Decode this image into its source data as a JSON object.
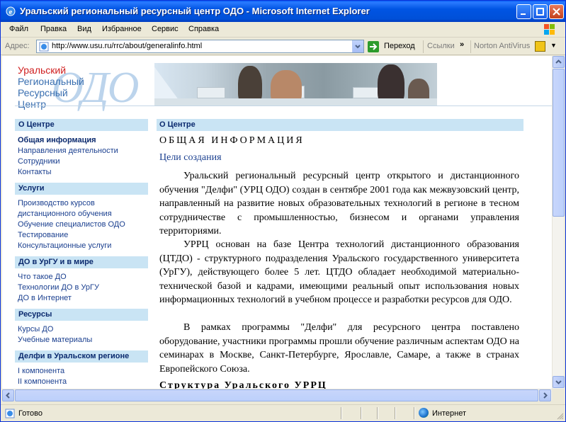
{
  "window": {
    "title": "Уральский региональный ресурсный центр ОДО - Microsoft Internet Explorer"
  },
  "menu": {
    "items": [
      {
        "label": "Файл"
      },
      {
        "label": "Правка"
      },
      {
        "label": "Вид"
      },
      {
        "label": "Избранное"
      },
      {
        "label": "Сервис"
      },
      {
        "label": "Справка"
      }
    ]
  },
  "address_bar": {
    "label": "Адрес:",
    "url": "http://www.usu.ru/rrc/about/generalinfo.html",
    "go_label": "Переход",
    "links_label": "Ссылки",
    "toolbar_more": "»",
    "norton_label": "Norton AntiVirus"
  },
  "logo": {
    "line1": "Уральский",
    "line2": "Региональный",
    "line3": "Ресурсный",
    "line4": "Центр",
    "watermark": "ОДО"
  },
  "sidebar": {
    "sections": [
      {
        "title": "О Центре",
        "links": [
          {
            "label": "Общая информация",
            "active": true
          },
          {
            "label": "Направления деятельности"
          },
          {
            "label": "Сотрудники"
          },
          {
            "label": "Контакты"
          }
        ]
      },
      {
        "title": "Услуги",
        "links": [
          {
            "label": "Производство курсов"
          },
          {
            "label": "дистанционного обучения"
          },
          {
            "label": "Обучение специалистов ОДО"
          },
          {
            "label": "Тестирование"
          },
          {
            "label": "Консультационные услуги"
          }
        ]
      },
      {
        "title": "ДО в УрГУ и в мире",
        "links": [
          {
            "label": "Что такое ДО"
          },
          {
            "label": "Технологии ДО в УрГУ"
          },
          {
            "label": "ДО в Интернет"
          }
        ]
      },
      {
        "title": "Ресурсы",
        "links": [
          {
            "label": "Курсы ДО"
          },
          {
            "label": "Учебные материалы"
          }
        ]
      },
      {
        "title": "Делфи в Уральском регионе",
        "links": [
          {
            "label": "I компонента"
          },
          {
            "label": "II компонента"
          }
        ]
      }
    ]
  },
  "main": {
    "header": "О Центре",
    "title": "ОБЩАЯ ИНФОРМАЦИЯ",
    "section_title": "Цели создания",
    "paragraphs": [
      "Уральский региональный ресурсный центр открытого и дистанционного обучения \"Делфи\" (УРЦ ОДО) создан в сентябре 2001 года как межвузовский центр, направленный на развитие новых образовательных технологий в регионе в тесном сотрудничестве с промышленностью, бизнесом и органами управления территориями.",
      "УРРЦ основан на базе Центра технологий дистанционного образования (ЦТДО) - структурного подразделения Уральского государственного университета (УрГУ), действующего более 5 лет. ЦТДО обладает необходимой материально-технической базой и кадрами, имеющими реальный опыт использования новых информационных технологий в учебном процессе и разработки ресурсов для ОДО.",
      "В рамках программы \"Делфи\" для ресурсного центра поставлено оборудование, участники программы прошли обучение различным аспектам ОДО на семинарах в Москве, Санкт-Петербурге, Ярославле, Самаре, а также в странах Европейского Союза."
    ],
    "next_section_title": "Структура Уральского УРРЦ"
  },
  "status_bar": {
    "text": "Готово",
    "zone": "Интернет"
  }
}
